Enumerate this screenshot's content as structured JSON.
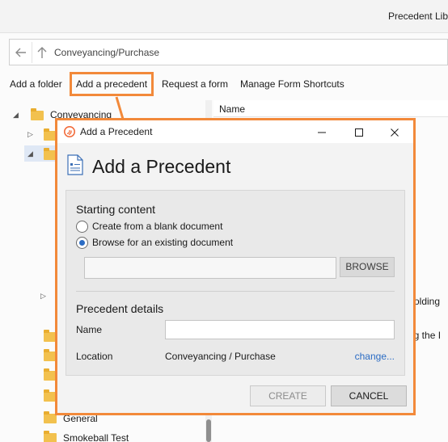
{
  "window": {
    "title": "Precedent Lib"
  },
  "address_bar": {
    "path": "Conveyancing/Purchase",
    "back_icon": "back-arrow-icon",
    "up_icon": "up-arrow-icon"
  },
  "command_bar": {
    "add_folder": "Add a folder",
    "add_precedent": "Add a precedent",
    "request_form": "Request a form",
    "manage_shortcuts": "Manage Form Shortcuts"
  },
  "tree": {
    "items": [
      {
        "label": "Conveyancing"
      },
      {
        "label": "General"
      },
      {
        "label": "Smokeball Test"
      }
    ]
  },
  "grid": {
    "column_name": "Name",
    "partial_rows": [
      "olding",
      "ng the I"
    ]
  },
  "dialog": {
    "title": "Add a Precedent",
    "heading": "Add a Precedent",
    "starting_content": {
      "title": "Starting content",
      "options": [
        {
          "label": "Create from a blank document",
          "checked": false
        },
        {
          "label": "Browse for an existing document",
          "checked": true
        }
      ],
      "path_value": "",
      "browse_label": "BROWSE"
    },
    "precedent_details": {
      "title": "Precedent details",
      "name_label": "Name",
      "name_value": "",
      "location_label": "Location",
      "location_value": "Conveyancing / Purchase",
      "change_label": "change..."
    },
    "create_label": "CREATE",
    "cancel_label": "CANCEL"
  },
  "colors": {
    "highlight": "#f2893a",
    "link": "#2b6cc4",
    "folder": "#f2c14e"
  }
}
